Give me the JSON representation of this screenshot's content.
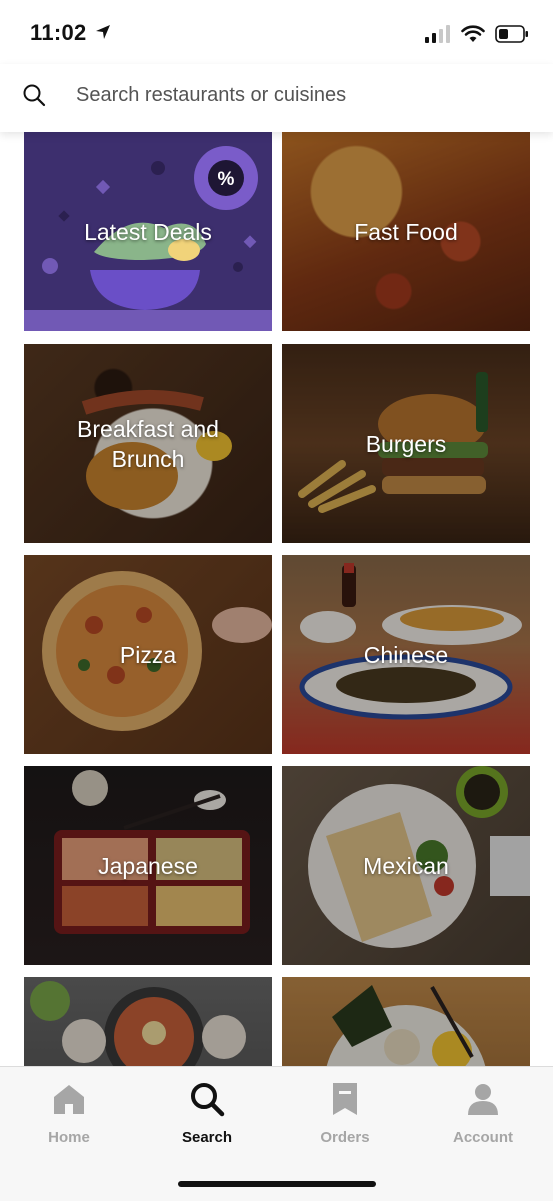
{
  "status_bar": {
    "time": "11:02"
  },
  "search": {
    "placeholder": "Search restaurants or cuisines"
  },
  "categories": [
    {
      "label": "Latest Deals"
    },
    {
      "label": "Fast Food"
    },
    {
      "label": "Breakfast and\nBrunch"
    },
    {
      "label": "Burgers"
    },
    {
      "label": "Pizza"
    },
    {
      "label": "Chinese"
    },
    {
      "label": "Japanese"
    },
    {
      "label": "Mexican"
    },
    {
      "label": ""
    },
    {
      "label": ""
    }
  ],
  "tabs": [
    {
      "label": "Home",
      "icon": "home-icon",
      "active": false
    },
    {
      "label": "Search",
      "icon": "search-icon",
      "active": true
    },
    {
      "label": "Orders",
      "icon": "receipt-icon",
      "active": false
    },
    {
      "label": "Account",
      "icon": "person-icon",
      "active": false
    }
  ],
  "colors": {
    "active_tab": "#111111",
    "inactive_tab": "#a6a6a6",
    "deals_purple": "#3d2f6e"
  }
}
